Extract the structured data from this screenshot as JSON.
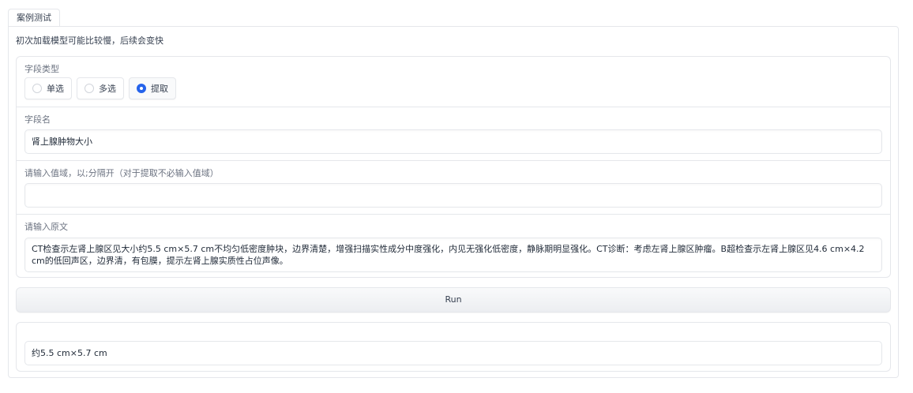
{
  "tab": {
    "label": "案例测试"
  },
  "note": "初次加载模型可能比较慢，后续会变快",
  "field_type": {
    "label": "字段类型",
    "options": [
      "单选",
      "多选",
      "提取"
    ],
    "selected": "提取"
  },
  "field_name": {
    "label": "字段名",
    "value": "肾上腺肿物大小"
  },
  "value_domain": {
    "label": "请输入值域，以;分隔开（对于提取不必输入值域）",
    "value": ""
  },
  "source_text": {
    "label": "请输入原文",
    "value": "CT检查示左肾上腺区见大小约5.5 cm×5.7 cm不均匀低密度肿块，边界清楚，增强扫描实性成分中度强化，内见无强化低密度，静脉期明显强化。CT诊断：考虑左肾上腺区肿瘤。B超检查示左肾上腺区见4.6 cm×4.2 cm的低回声区，边界清，有包膜，提示左肾上腺实质性占位声像。"
  },
  "run_button": {
    "label": "Run"
  },
  "output": {
    "value": "约5.5 cm×5.7 cm"
  },
  "colors": {
    "accent": "#2563eb",
    "border": "#e5e7eb",
    "text": "#374151"
  }
}
